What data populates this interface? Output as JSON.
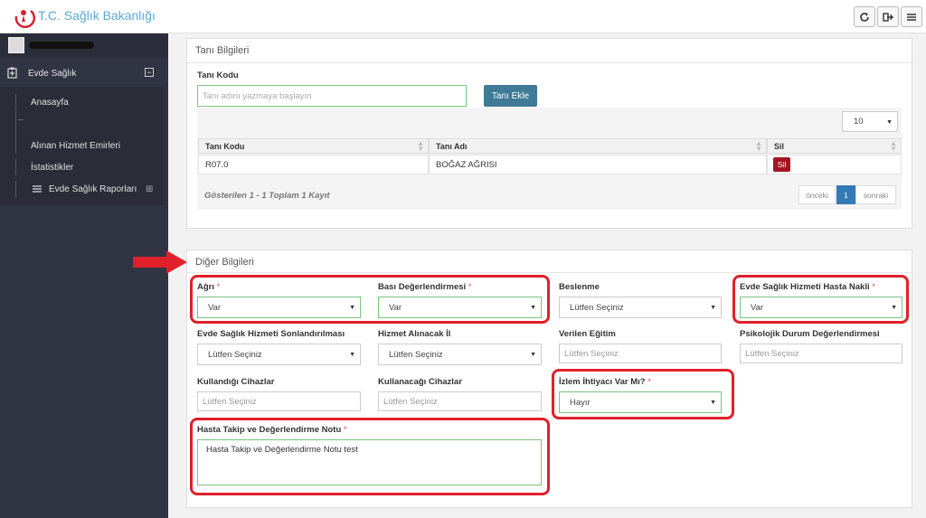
{
  "header": {
    "logo_text": "T.C. Sağlık Bakanlığı",
    "buttons": [
      {
        "icon": "refresh-icon"
      },
      {
        "icon": "logout-icon"
      },
      {
        "icon": "menu-icon"
      }
    ]
  },
  "sidebar": {
    "main_label": "Evde Sağlık",
    "toggle": "⊟",
    "items": [
      {
        "label": "Anasayfa"
      },
      {
        "label": ""
      },
      {
        "label": "Alınan Hizmet Emirleri"
      },
      {
        "label": "İstatistikler"
      },
      {
        "label": "Evde Sağlık Raporları"
      }
    ],
    "reports_toggle": "⊞"
  },
  "tani_panel": {
    "title": "Tanı Bilgileri",
    "field_label": "Tanı Kodu",
    "input_placeholder": "Tanı adını yazmaya başlayın",
    "add_button": "Tanı Ekle",
    "page_size": "10",
    "columns": [
      "Tanı Kodu",
      "Tanı Adı",
      "Sil"
    ],
    "rows": [
      {
        "code": "R07.0",
        "name": "BOĞAZ AĞRISI",
        "action": "Sil"
      }
    ],
    "footer": "Gösterilen 1 - 1 Toplam 1 Kayıt",
    "pagination": {
      "prev": "önceki",
      "current": "1",
      "next": "sonraki"
    }
  },
  "diger_panel": {
    "title": "Diğer Bilgileri",
    "fields": {
      "agri": {
        "label": "Ağrı",
        "value": "Var"
      },
      "basi": {
        "label": "Bası Değerlendirmesi",
        "value": "Var"
      },
      "beslenme": {
        "label": "Beslenme",
        "value": "Lütfen Seçiniz"
      },
      "nakil": {
        "label": "Evde Sağlık Hizmeti Hasta Nakli",
        "value": "Var"
      },
      "sonlandirilmasi": {
        "label": "Evde Sağlık Hizmeti Sonlandırılması",
        "value": "Lütfen Seçiniz"
      },
      "hizmet_il": {
        "label": "Hizmet Alınacak İl",
        "value": "Lütfen Seçiniz"
      },
      "egitim": {
        "label": "Verilen Eğitim",
        "placeholder": "Lütfen Seçiniz"
      },
      "psikolojik": {
        "label": "Psikolojik Durum Değerlendirmesi",
        "placeholder": "Lütfen Seçiniz"
      },
      "kullandigi": {
        "label": "Kullandığı Cihazlar",
        "placeholder": "Lütfen Seçiniz"
      },
      "kullanacagi": {
        "label": "Kullanacağı Cihazlar",
        "placeholder": "Lütfen Seçiniz"
      },
      "izlem": {
        "label": "İzlem İhtiyacı Var Mı?",
        "value": "Hayır"
      },
      "not": {
        "label": "Hasta Takip ve Değerlendirme Notu",
        "value": "Hasta Takip ve Değerlendirme Notu test"
      }
    },
    "required_mark": "*"
  },
  "colors": {
    "sidebar": "#313442",
    "accent": "#3f7a96",
    "highlight": "#e0212b",
    "delete": "#a31621"
  }
}
